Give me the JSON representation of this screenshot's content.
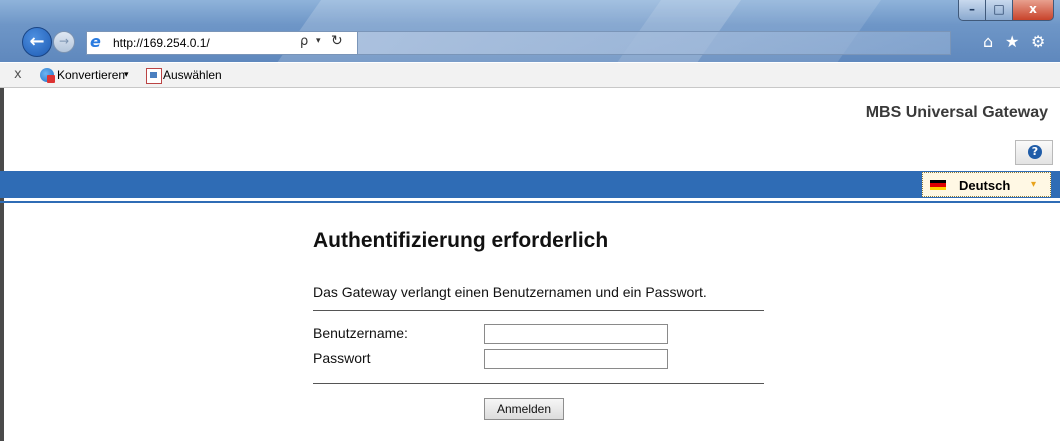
{
  "browser": {
    "window_controls": {
      "minimize": "–",
      "maximize": "□",
      "close": "x"
    },
    "nav": {
      "back_glyph": "←",
      "forward_glyph": "→"
    },
    "address": {
      "url": "http://169.254.0.1/",
      "search_glyph": "ρ",
      "dropdown_glyph": "▾",
      "refresh_glyph": "↻"
    },
    "toolbar_icons": {
      "home": "⌂",
      "favorites": "★",
      "tools": "⚙"
    },
    "command_bar": {
      "close_glyph": "x",
      "convert_label": "Konvertieren",
      "convert_caret": "▾",
      "select_label": "Auswählen"
    },
    "icons": [
      "back-arrow-icon",
      "forward-arrow-icon",
      "ie-logo-icon",
      "search-icon",
      "refresh-icon",
      "home-icon",
      "star-icon",
      "gear-icon"
    ]
  },
  "page": {
    "product_title": "MBS Universal Gateway",
    "help_glyph": "?",
    "language": {
      "selected": "Deutsch",
      "arrow": "▾",
      "flag_colors": [
        "#000000",
        "#dd0000",
        "#ffce00"
      ]
    },
    "auth": {
      "heading": "Authentifizierung erforderlich",
      "description": "Das Gateway verlangt einen Benutzernamen und ein Passwort.",
      "username_label": "Benutzername:",
      "password_label": "Passwort",
      "username_value": "",
      "password_value": "",
      "submit_label": "Anmelden"
    },
    "colors": {
      "band": "#2f6cb5",
      "title": "#3a3a3a"
    }
  }
}
